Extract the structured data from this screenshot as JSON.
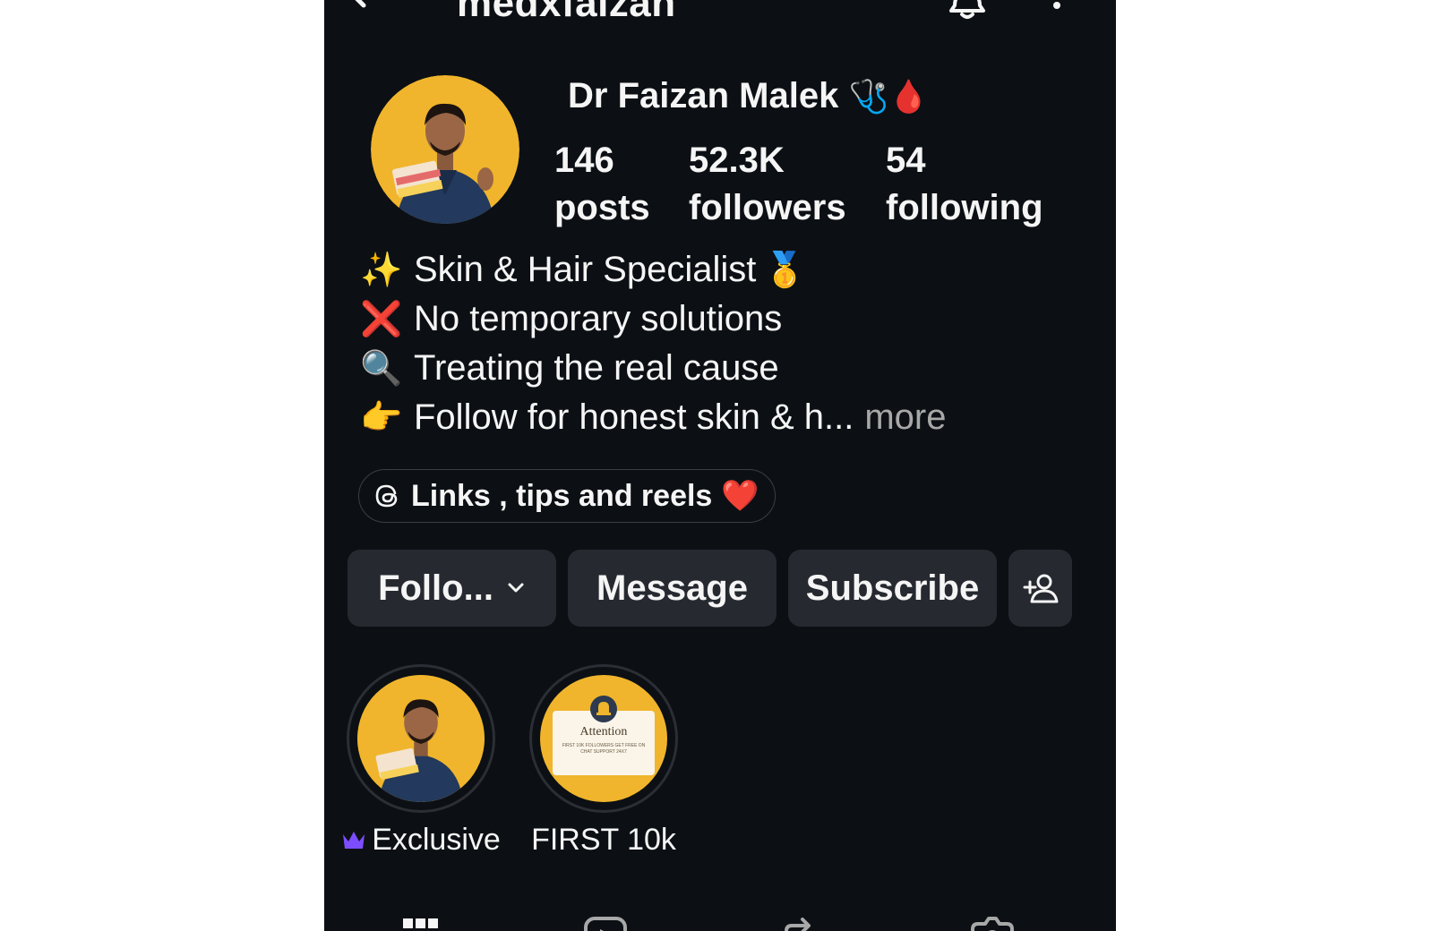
{
  "header": {
    "username": "medxfaizan"
  },
  "profile": {
    "display_name": "Dr Faizan Malek",
    "name_emoji": "🩺🩸",
    "stats": [
      {
        "value": "146",
        "label": "posts"
      },
      {
        "value": "52.3K",
        "label": "followers"
      },
      {
        "value": "54",
        "label": "following"
      }
    ]
  },
  "bio": {
    "lines": [
      {
        "emoji": "✨",
        "text": "Skin & Hair Specialist",
        "trail": "🥇"
      },
      {
        "emoji": "❌",
        "text": "No temporary solutions",
        "trail": ""
      },
      {
        "emoji": "🔍",
        "text": "Treating the real cause",
        "trail": ""
      },
      {
        "emoji": "👉",
        "text": "Follow for honest skin & h...",
        "trail": ""
      }
    ],
    "more_label": "more"
  },
  "link": {
    "text": "Links , tips and reels",
    "emoji": "❤️"
  },
  "actions": {
    "follow": "Follo...",
    "message": "Message",
    "subscribe": "Subscribe"
  },
  "highlights": [
    {
      "label": "Exclusive"
    },
    {
      "label": "FIRST 10k",
      "cover_title": "Attention",
      "cover_text": "FIRST 10K FOLLOWERS GET FREE ON CHAT SUPPORT 24X7"
    }
  ],
  "colors": {
    "background": "#0c1014",
    "button": "#262a30",
    "text": "#f5f5f5",
    "muted": "#a8a8a8",
    "avatar_bg": "#f0b52c",
    "crown": "#7c4dff"
  }
}
